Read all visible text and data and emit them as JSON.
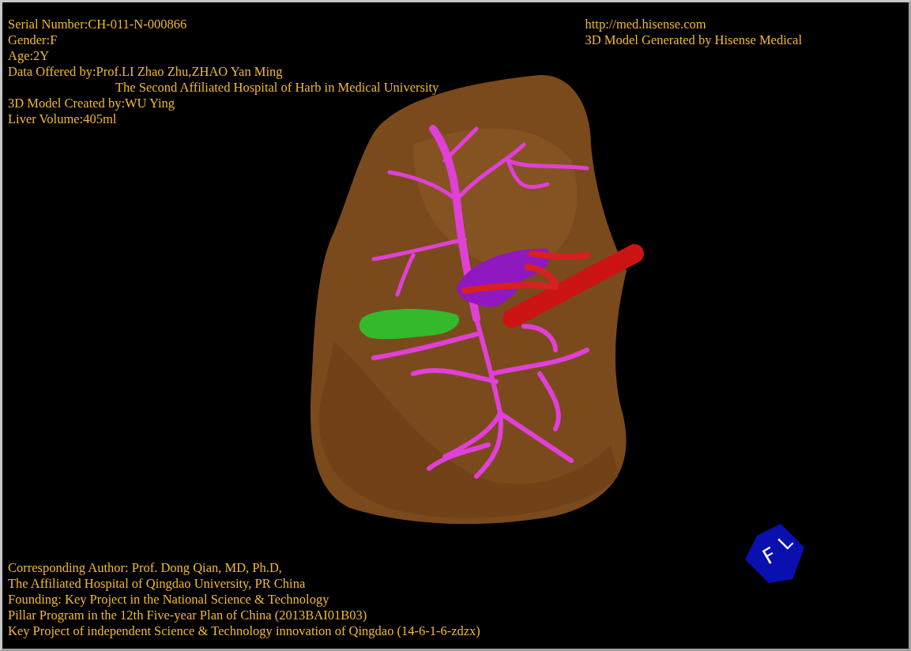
{
  "top_left": [
    {
      "kind": "line",
      "text": "Serial Number:CH-011-N-000866"
    },
    {
      "kind": "line",
      "text": "Gender:F"
    },
    {
      "kind": "line",
      "text": "Age:2Y"
    },
    {
      "kind": "line",
      "text": "Data Offered by:Prof.LI Zhao Zhu,ZHAO Yan Ming"
    },
    {
      "kind": "indented",
      "text": "The Second Affiliated Hospital of Harb in Medical University"
    },
    {
      "kind": "line",
      "text": "3D Model Created by:WU Ying"
    },
    {
      "kind": "line",
      "text": "Liver Volume:405ml"
    }
  ],
  "top_right": [
    "http://med.hisense.com",
    "3D Model Generated by Hisense Medical"
  ],
  "bottom_left": [
    "Corresponding Author: Prof. Dong Qian, MD, Ph.D,",
    "The Affiliated Hospital of Qingdao University, PR China",
    "Founding: Key Project in the National Science & Technology",
    "Pillar Program in the 12th Five-year Plan of China (2013BAI01B03)",
    "Key Project of independent Science & Technology innovation of Qingdao (14-6-1-6-zdzx)"
  ],
  "orientation_cube": {
    "faces": [
      "F",
      "L"
    ]
  }
}
